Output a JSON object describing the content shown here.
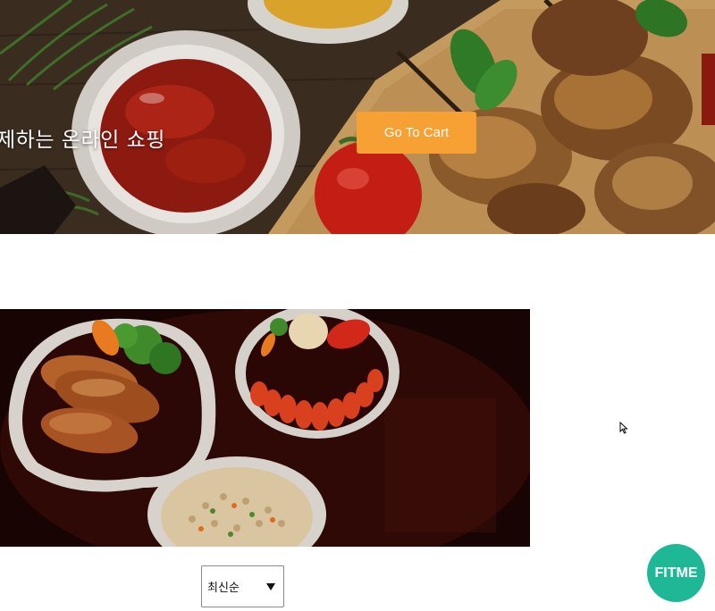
{
  "hero": {
    "tagline": "제하는 온라인 쇼핑",
    "cart_button": "Go To Cart"
  },
  "sort": {
    "selected": "최신순"
  },
  "fitme": {
    "label": "FITME"
  },
  "colors": {
    "cart_button": "#f7a135",
    "fitme": "#1fb896"
  }
}
